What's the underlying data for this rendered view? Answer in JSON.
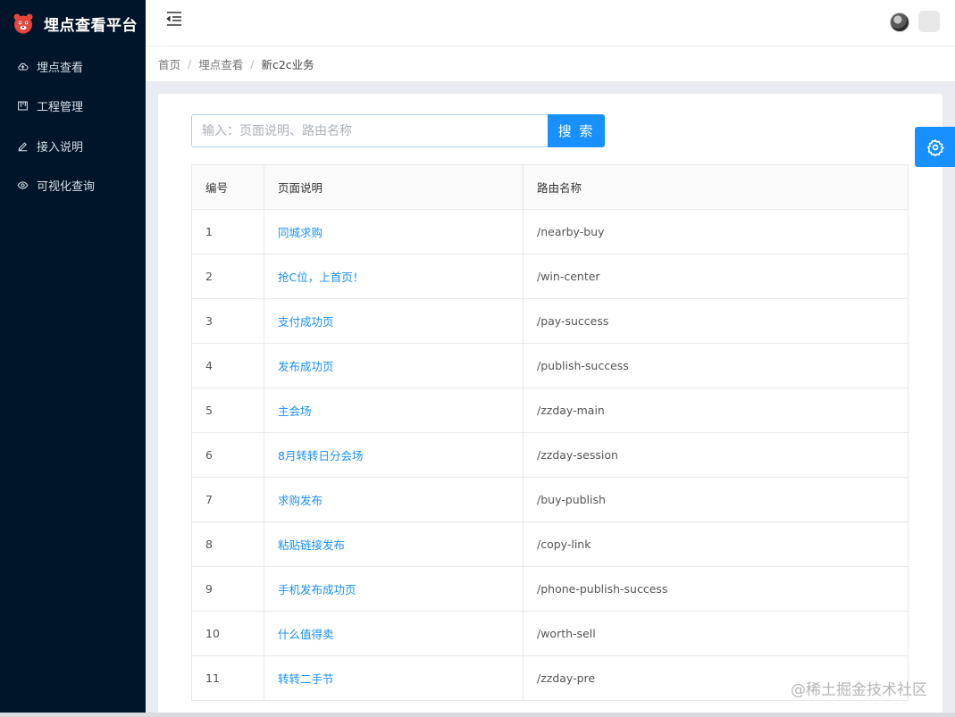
{
  "app": {
    "title": "埋点查看平台",
    "logo_icon": "bear-logo-icon"
  },
  "sidebar": {
    "items": [
      {
        "label": "埋点查看",
        "icon": "cloud-icon"
      },
      {
        "label": "工程管理",
        "icon": "project-icon"
      },
      {
        "label": "接入说明",
        "icon": "edit-icon"
      },
      {
        "label": "可视化查询",
        "icon": "eye-icon"
      }
    ]
  },
  "header": {
    "fold_icon": "menu-fold-icon",
    "avatar_icon": "avatar"
  },
  "breadcrumb": [
    "首页",
    "埋点查看",
    "新c2c业务"
  ],
  "search": {
    "placeholder": "输入：页面说明、路由名称",
    "value": "",
    "button_label": "搜 索"
  },
  "table": {
    "columns": [
      "编号",
      "页面说明",
      "路由名称"
    ],
    "rows": [
      {
        "id": "1",
        "desc": "同城求购",
        "route": "/nearby-buy"
      },
      {
        "id": "2",
        "desc": "抢C位，上首页！",
        "route": "/win-center"
      },
      {
        "id": "3",
        "desc": "支付成功页",
        "route": "/pay-success"
      },
      {
        "id": "4",
        "desc": "发布成功页",
        "route": "/publish-success"
      },
      {
        "id": "5",
        "desc": "主会场",
        "route": "/zzday-main"
      },
      {
        "id": "6",
        "desc": "8月转转日分会场",
        "route": "/zzday-session"
      },
      {
        "id": "7",
        "desc": "求购发布",
        "route": "/buy-publish"
      },
      {
        "id": "8",
        "desc": "粘贴链接发布",
        "route": "/copy-link"
      },
      {
        "id": "9",
        "desc": "手机发布成功页",
        "route": "/phone-publish-success"
      },
      {
        "id": "10",
        "desc": "什么值得卖",
        "route": "/worth-sell"
      },
      {
        "id": "11",
        "desc": "转转二手节",
        "route": "/zzday-pre"
      }
    ]
  },
  "settings_icon": "gear-icon",
  "watermark": "@稀土掘金技术社区",
  "colors": {
    "sidebar_bg": "#001529",
    "accent": "#1890ff",
    "page_bg": "#e9ecf0"
  }
}
